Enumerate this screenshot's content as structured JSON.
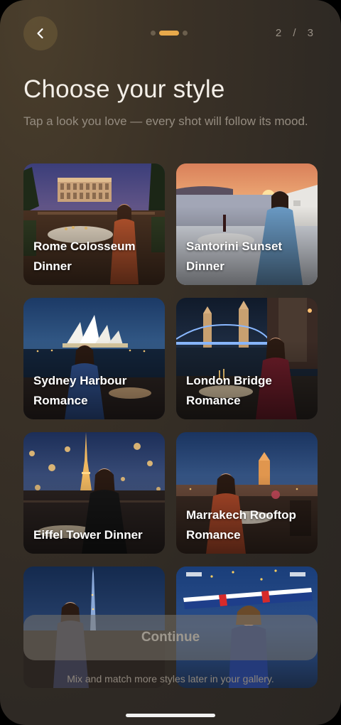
{
  "header": {
    "step_counter": "2 / 3"
  },
  "page": {
    "title": "Choose your style",
    "subtitle": "Tap a look you love — every shot will follow its mood."
  },
  "styles": [
    {
      "label": "Rome Colosseum Dinner"
    },
    {
      "label": "Santorini Sunset Dinner"
    },
    {
      "label": "Sydney Harbour Romance"
    },
    {
      "label": "London Bridge Romance"
    },
    {
      "label": "Eiffel Tower Dinner"
    },
    {
      "label": "Marrakech Rooftop Romance"
    },
    {
      "label": ""
    },
    {
      "label": ""
    }
  ],
  "actions": {
    "continue_label": "Continue",
    "footer_note": "Mix and match more styles later in your gallery."
  },
  "colors": {
    "accent": "#e7a94b",
    "background": "#2e2924"
  }
}
